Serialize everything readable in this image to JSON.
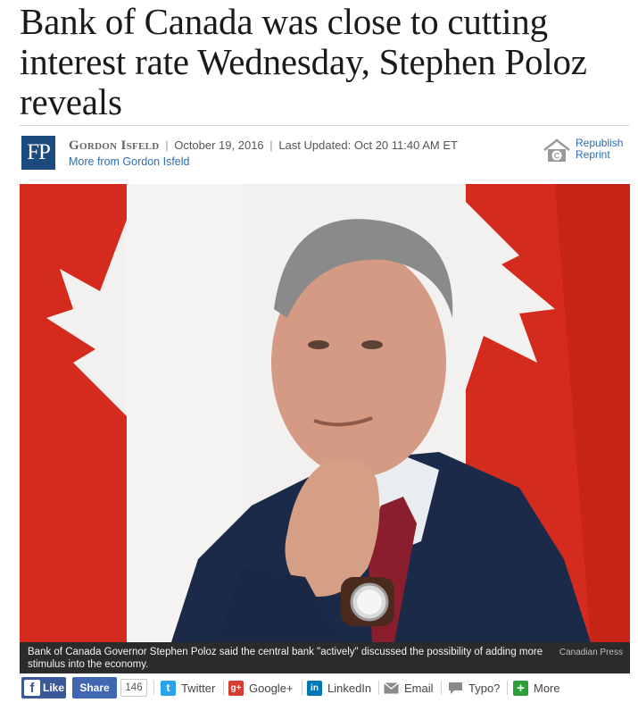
{
  "article": {
    "headline": "Bank of Canada was close to cutting interest rate Wednesday, Stephen Poloz reveals",
    "publisher_logo": "FP",
    "author": "Gordon Isfeld",
    "date": "October 19, 2016",
    "updated": "Last Updated: Oct 20 11:40 AM ET",
    "more_from": "More from Gordon Isfeld"
  },
  "republish": {
    "republish_label": "Republish",
    "reprint_label": "Reprint",
    "icon": "copyright-house-icon"
  },
  "photo": {
    "caption": "Bank of Canada Governor Stephen Poloz said the central bank \"actively\" discussed the possibility of adding more stimulus into the economy.",
    "credit": "Canadian Press"
  },
  "share": {
    "like_label": "Like",
    "share_label": "Share",
    "share_count": "146",
    "twitter_label": "Twitter",
    "googleplus_label": "Google+",
    "linkedin_label": "LinkedIn",
    "email_label": "Email",
    "typo_label": "Typo?",
    "more_label": "More"
  },
  "colors": {
    "fp_blue": "#1a4b7c",
    "link_blue": "#2e6eb0",
    "facebook": "#3b5998",
    "twitter": "#2aa3ef",
    "googleplus": "#d73d32",
    "linkedin": "#0077b5",
    "flag_red": "#d52b1e"
  }
}
